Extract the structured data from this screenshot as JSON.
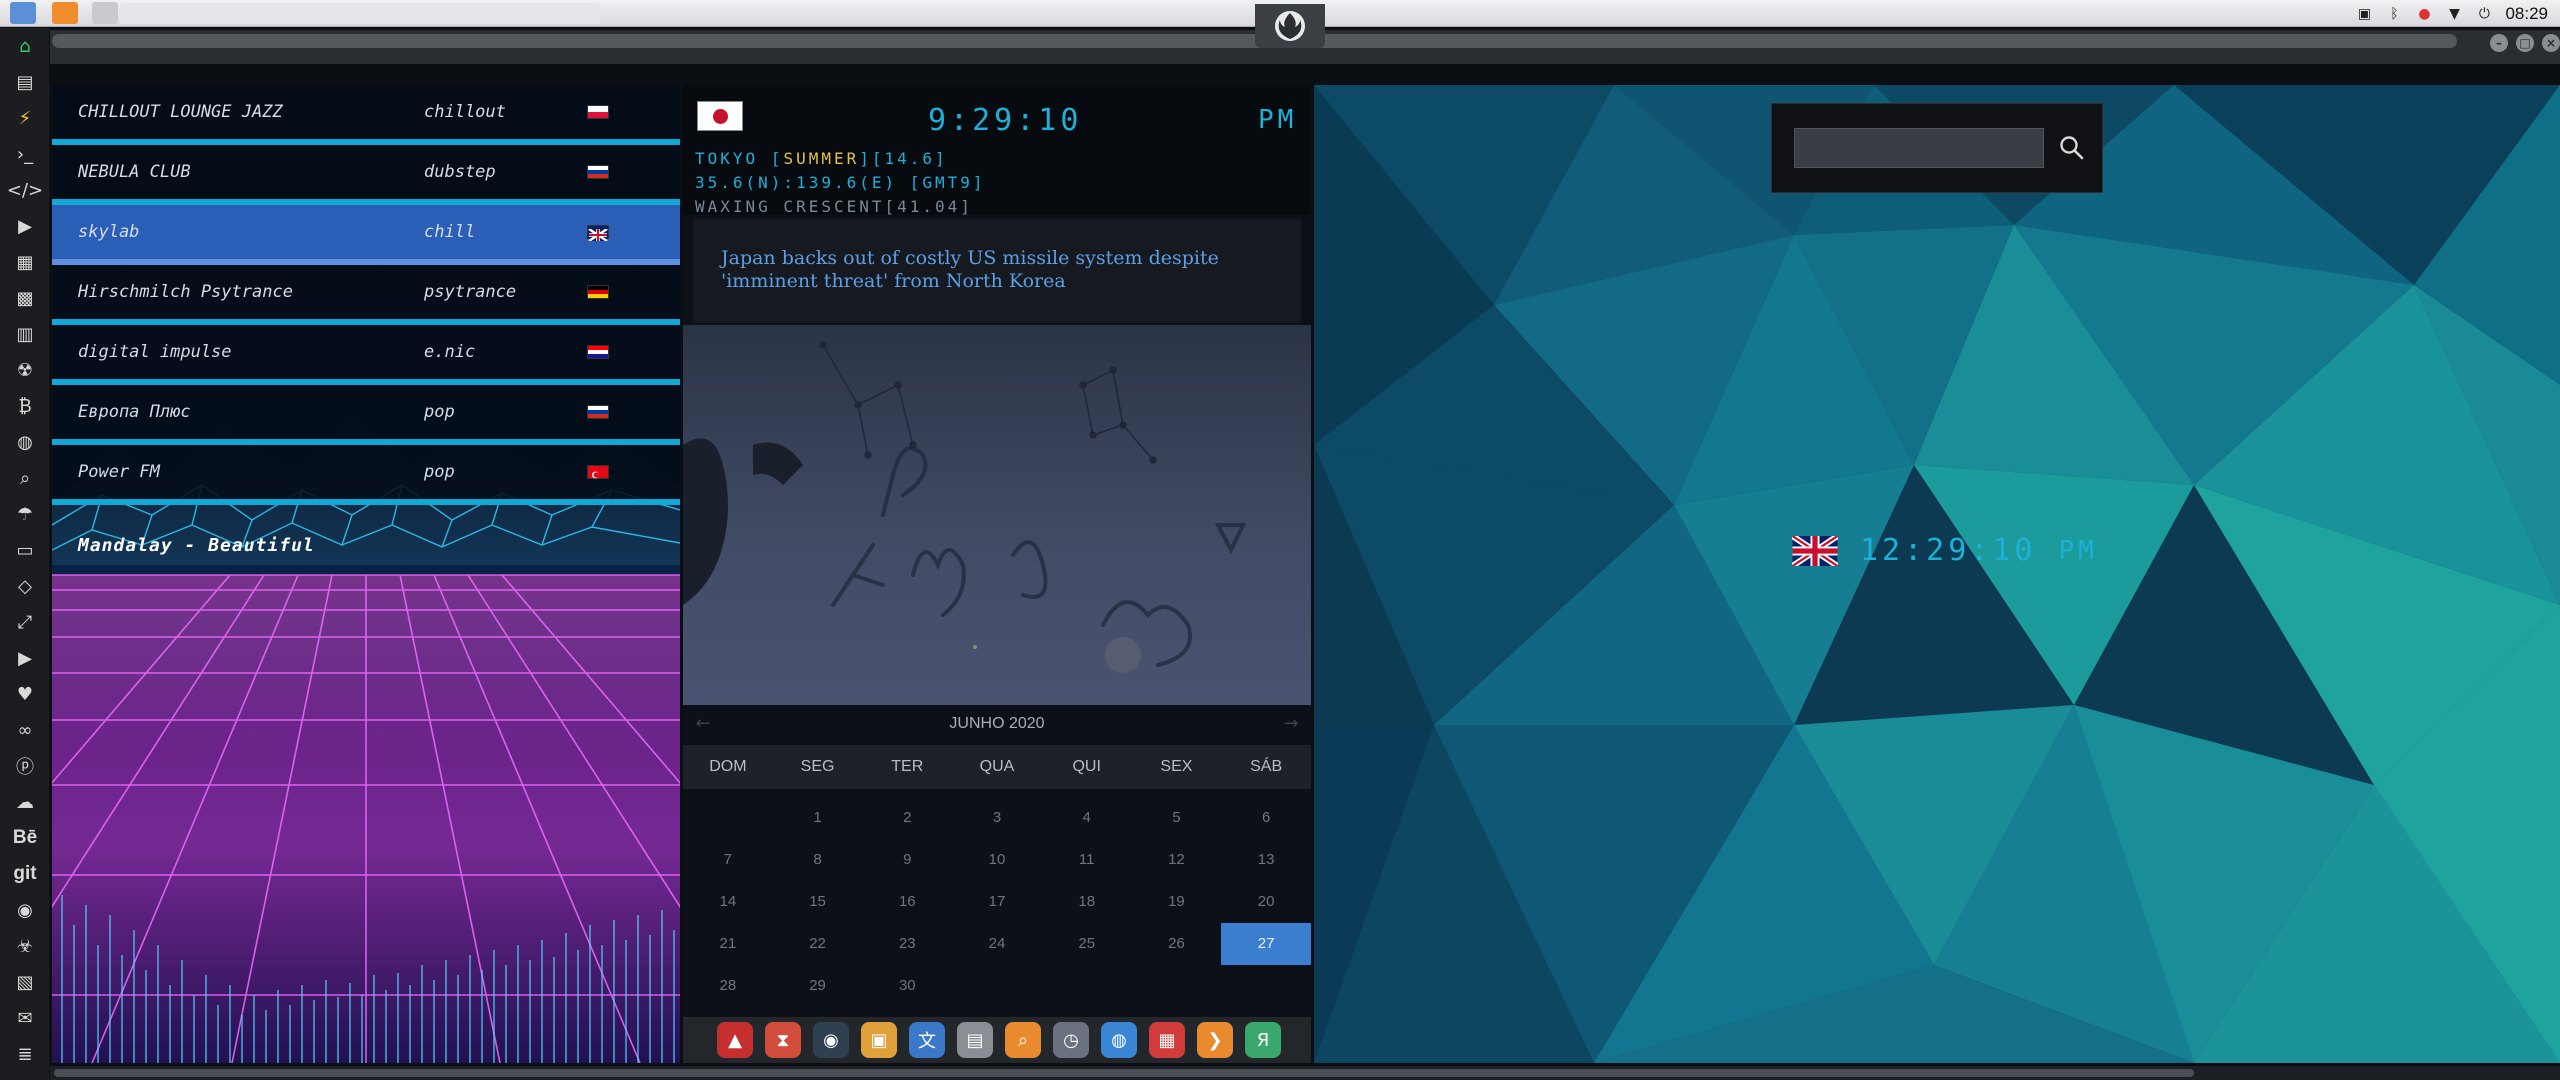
{
  "system_tray": {
    "time": "08:29"
  },
  "sidebar": {
    "items": [
      "home",
      "document",
      "bolt",
      "terminal",
      "code",
      "play",
      "portfolio",
      "image",
      "newspaper",
      "radiation",
      "bitcoin",
      "globe",
      "search",
      "umbrella",
      "id-card",
      "tag",
      "fullscreen",
      "youtube",
      "heart",
      "lastfm",
      "pinterest",
      "cloud",
      "Bē",
      "git",
      "github",
      "biohazard",
      "map",
      "envelope",
      "server"
    ]
  },
  "radio": {
    "stations": [
      {
        "name": "CHILLOUT LOUNGE JAZZ",
        "genre": "chillout",
        "flag": "pl"
      },
      {
        "name": "NEBULA CLUB",
        "genre": "dubstep",
        "flag": "ru"
      },
      {
        "name": "skylab",
        "genre": "chill",
        "flag": "uk",
        "selected": true
      },
      {
        "name": "Hirschmilch Psytrance",
        "genre": "psytrance",
        "flag": "de"
      },
      {
        "name": "digital impulse",
        "genre": "e.nic",
        "flag": "hr"
      },
      {
        "name": "Европа Плюс",
        "genre": "pop",
        "flag": "ru"
      },
      {
        "name": "Power FM",
        "genre": "pop",
        "flag": "tr"
      }
    ],
    "now_playing": "Mandalay - Beautiful"
  },
  "japan_clock": {
    "time": "9:29:10",
    "ampm": "PM",
    "line1_prefix": "TOKYO [",
    "line1_season": "SUMMER",
    "line1_suffix": "][14.6]",
    "line2": "35.6(N):139.6(E) [GMT9]",
    "line3": "WAXING CRESCENT[41.04]"
  },
  "news": {
    "headline": "Japan backs out of costly US missile system despite 'imminent threat' from North Korea"
  },
  "calendar": {
    "title": "JUNHO 2020",
    "prev": "←",
    "next": "→",
    "weekdays": [
      "DOM",
      "SEG",
      "TER",
      "QUA",
      "QUI",
      "SEX",
      "SÁB"
    ],
    "leading_blanks": 1,
    "days": [
      "1",
      "2",
      "3",
      "4",
      "5",
      "6",
      "7",
      "8",
      "9",
      "10",
      "11",
      "12",
      "13",
      "14",
      "15",
      "16",
      "17",
      "18",
      "19",
      "20",
      "21",
      "22",
      "23",
      "24",
      "25",
      "26",
      "27",
      "28",
      "29",
      "30"
    ],
    "today": "27"
  },
  "dock": {
    "apps": [
      {
        "icon": "arch-triangle",
        "color": "#c62f2f"
      },
      {
        "icon": "hourglass",
        "color": "#d34d3d"
      },
      {
        "icon": "globe-dark",
        "color": "#2f4050"
      },
      {
        "icon": "photos",
        "color": "#e0a03a"
      },
      {
        "icon": "translate",
        "color": "#3a78c8"
      },
      {
        "icon": "calendar-sheet",
        "color": "#8a8f96"
      },
      {
        "icon": "search",
        "color": "#e98a2e"
      },
      {
        "icon": "clock",
        "color": "#6a7280"
      },
      {
        "icon": "globe",
        "color": "#3a86d4"
      },
      {
        "icon": "calendar",
        "color": "#d23b3b"
      },
      {
        "icon": "arrow",
        "color": "#e98a2e"
      },
      {
        "icon": "yandex",
        "color": "#3aa86d"
      }
    ]
  },
  "search": {
    "value": "",
    "placeholder": ""
  },
  "uk_clock": {
    "time": "12:29:10",
    "ampm": "PM"
  },
  "colors": {
    "accent_cyan": "#1bb1d8",
    "calendar_today": "#3b7ed0",
    "news_link": "#5aa0e6",
    "selected_station": "#2b5fb7"
  }
}
